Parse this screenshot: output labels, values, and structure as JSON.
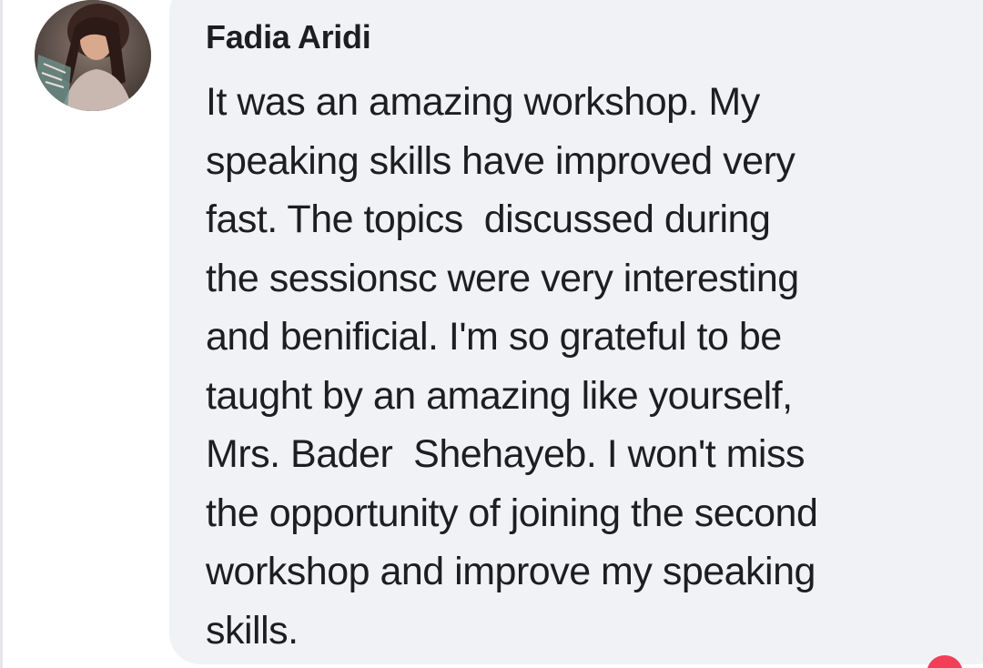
{
  "comment": {
    "author": "Fadia Aridi",
    "lines": [
      "It was an amazing workshop. My",
      "speaking skills have improved very",
      "fast. The topics  discussed during",
      "the sessionsc were very interesting",
      "and benificial. I'm so grateful to be",
      "taught by an amazing like yourself,",
      "Mrs. Bader  Shehayeb. I won't miss",
      "the opportunity of joining the second",
      "workshop and improve my speaking",
      "skills."
    ]
  },
  "colors": {
    "bubble": "#f0f2f5",
    "text": "#1c1e21",
    "reaction": "#f33e58"
  },
  "icons": {
    "avatar": "profile-photo",
    "reaction": "reaction-icon"
  }
}
